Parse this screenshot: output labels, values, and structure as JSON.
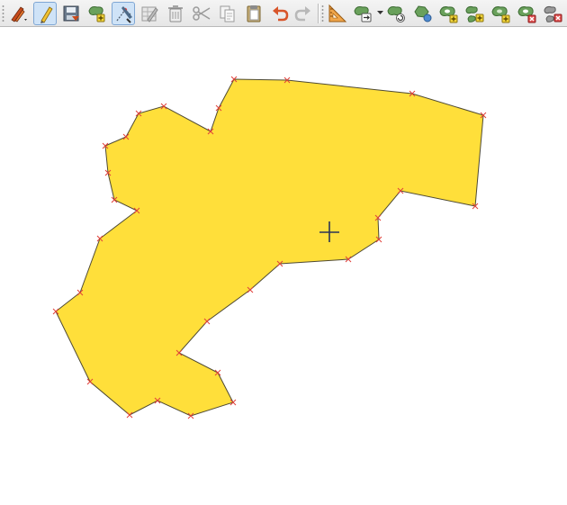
{
  "toolbar": {
    "tools": [
      {
        "name": "current-edits-button",
        "icon": "pencils-icon",
        "dropdown": true
      },
      {
        "name": "toggle-editing-button",
        "icon": "pencil-icon",
        "active": true
      },
      {
        "name": "save-layer-edits-button",
        "icon": "save-icon"
      },
      {
        "name": "add-polygon-feature-button",
        "icon": "add-polygon-icon"
      },
      {
        "name": "vertex-tool-button",
        "icon": "vertex-tool-icon",
        "active": true
      },
      {
        "name": "modify-attributes-button",
        "icon": "edit-table-icon"
      },
      {
        "name": "delete-selected-button",
        "icon": "trash-icon"
      },
      {
        "name": "cut-features-button",
        "icon": "scissors-icon"
      },
      {
        "name": "copy-features-button",
        "icon": "copy-icon"
      },
      {
        "name": "paste-features-button",
        "icon": "paste-icon"
      },
      {
        "name": "undo-button",
        "icon": "undo-icon"
      },
      {
        "name": "redo-button",
        "icon": "redo-icon"
      },
      {
        "name": "digitizing-options-button",
        "icon": "set-square-icon"
      },
      {
        "name": "move-feature-button",
        "icon": "move-feature-icon",
        "dropdown": true
      },
      {
        "name": "rotate-feature-button",
        "icon": "rotate-feature-icon"
      },
      {
        "name": "simplify-feature-button",
        "icon": "simplify-feature-icon"
      },
      {
        "name": "add-ring-button",
        "icon": "add-ring-icon"
      },
      {
        "name": "add-part-button",
        "icon": "add-part-icon"
      },
      {
        "name": "fill-ring-button",
        "icon": "fill-ring-icon"
      },
      {
        "name": "delete-ring-button",
        "icon": "delete-ring-icon"
      },
      {
        "name": "delete-part-button",
        "icon": "delete-part-icon"
      }
    ]
  },
  "map": {
    "polygon": {
      "fill": "#ffdf3a",
      "stroke": "#4f4a33",
      "vertex_color": "#e0403a"
    },
    "cursor": "crosshair-icon"
  }
}
